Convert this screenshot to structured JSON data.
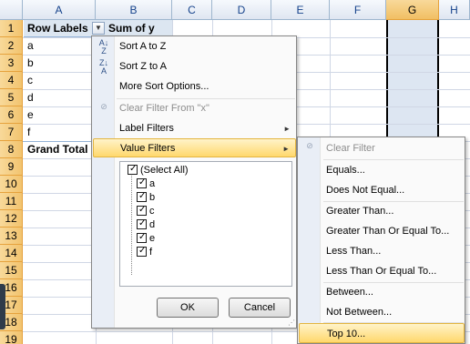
{
  "columns": [
    "A",
    "B",
    "C",
    "D",
    "E",
    "F",
    "G",
    "H"
  ],
  "rows": [
    "1",
    "2",
    "3",
    "4",
    "5",
    "6",
    "7",
    "8",
    "9",
    "10",
    "11",
    "12",
    "13",
    "14",
    "15",
    "16",
    "17",
    "18",
    "19"
  ],
  "pivot": {
    "header_row_labels": "Row Labels",
    "header_sum": "Sum of y",
    "items": [
      "a",
      "b",
      "c",
      "d",
      "e",
      "f"
    ],
    "grand_total": "Grand Total"
  },
  "menu": {
    "sort_az": "Sort A to Z",
    "sort_za": "Sort Z to A",
    "more_sort": "More Sort Options...",
    "clear_filter": "Clear Filter From \"x\"",
    "label_filters": "Label Filters",
    "value_filters": "Value Filters",
    "select_all": "(Select All)",
    "checklist": [
      "a",
      "b",
      "c",
      "d",
      "e",
      "f"
    ],
    "ok": "OK",
    "cancel": "Cancel"
  },
  "submenu": {
    "clear_filter": "Clear Filter",
    "equals": "Equals...",
    "not_equal": "Does Not Equal...",
    "greater": "Greater Than...",
    "greater_eq": "Greater Than Or Equal To...",
    "less": "Less Than...",
    "less_eq": "Less Than Or Equal To...",
    "between": "Between...",
    "not_between": "Not Between...",
    "top10": "Top 10..."
  },
  "icons": {
    "sort_az": "sort-ascending-icon",
    "sort_za": "sort-descending-icon",
    "clear_filter": "clear-filter-icon",
    "dropdown": "dropdown-arrow-icon",
    "submenu_arrow": "submenu-arrow-icon"
  },
  "colors": {
    "selection_header": "#f1bf63",
    "menu_hover": "#ffd86d",
    "selected_column": "#dde6f2",
    "pivot_header": "#dce6f1"
  }
}
